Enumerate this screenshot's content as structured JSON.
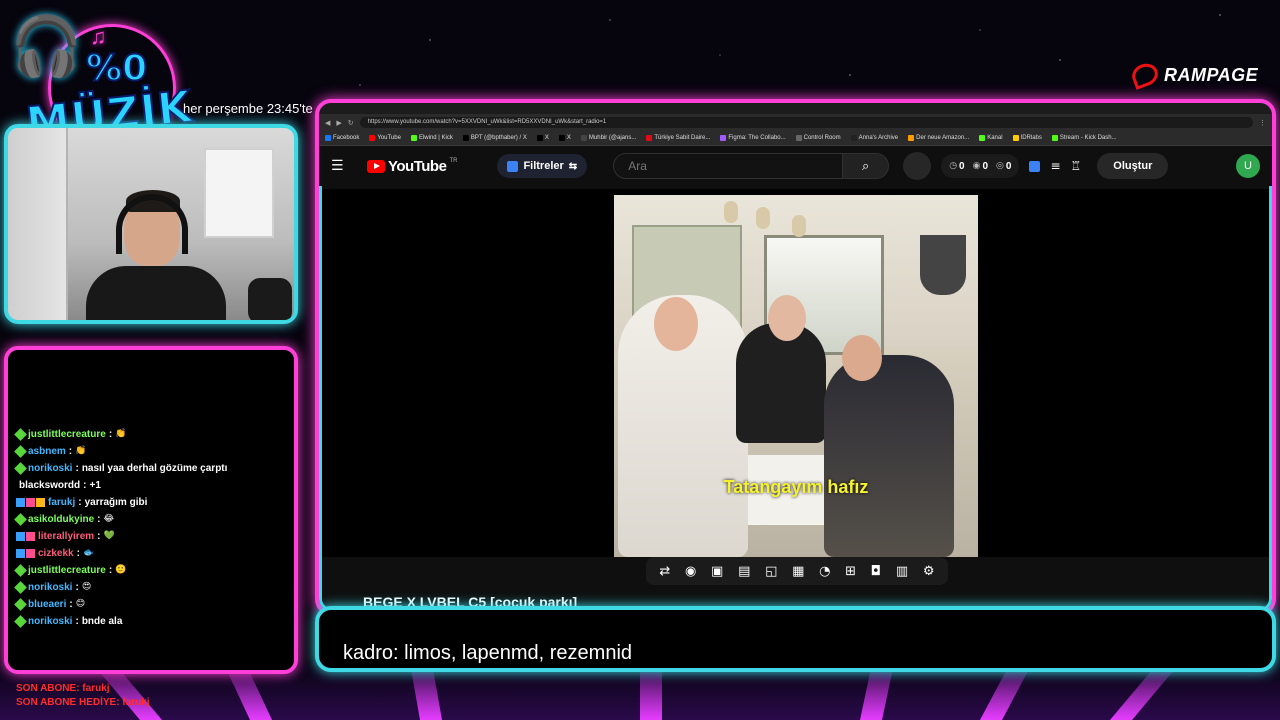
{
  "overlay": {
    "logo": {
      "percent": "%0",
      "word": "MÜZİK"
    },
    "schedule": "her perşembe 23:45'te",
    "sponsor": "RAMPAGE",
    "caption": "kadro: limos, lapenmd, rezemnid",
    "subs": {
      "last_sub": "SON ABONE: farukj",
      "last_gift": "SON ABONE HEDİYE: farukj"
    }
  },
  "chat": {
    "messages": [
      {
        "user": "justlittlecreature",
        "text": "",
        "emoji": "👏",
        "color": "green",
        "badges": [
          "green"
        ]
      },
      {
        "user": "asbnem",
        "text": "",
        "emoji": "👏",
        "color": "cyan",
        "badges": [
          "green"
        ]
      },
      {
        "user": "norikoski",
        "text": "nasıl yaa derhal gözüme çarptı",
        "emoji": "",
        "color": "cyan",
        "badges": [
          "green"
        ]
      },
      {
        "user": "blackswordd",
        "text": "+1",
        "emoji": "",
        "color": "white",
        "badges": []
      },
      {
        "user": "farukj",
        "text": "yarrağım gibi",
        "emoji": "",
        "color": "cyan",
        "badges": [
          "blue",
          "pink",
          "gold"
        ]
      },
      {
        "user": "asikoldukyine",
        "text": "",
        "emoji": "😂",
        "color": "green",
        "badges": [
          "green"
        ]
      },
      {
        "user": "literallyirem",
        "text": "",
        "emoji": "💚",
        "color": "pink",
        "badges": [
          "blue",
          "pink"
        ]
      },
      {
        "user": "cizkekk",
        "text": "",
        "emoji": "🐟",
        "color": "pink",
        "badges": [
          "blue",
          "pink"
        ]
      },
      {
        "user": "justlittlecreature",
        "text": "",
        "emoji": "🙂",
        "color": "green",
        "badges": [
          "green"
        ]
      },
      {
        "user": "norikoski",
        "text": "",
        "emoji": "😍",
        "color": "cyan",
        "badges": [
          "green"
        ]
      },
      {
        "user": "blueaeri",
        "text": "",
        "emoji": "😊",
        "color": "cyan",
        "badges": [
          "green"
        ]
      },
      {
        "user": "norikoski",
        "text": "bnde ala",
        "emoji": "",
        "color": "cyan",
        "badges": [
          "green"
        ]
      }
    ]
  },
  "browser": {
    "url": "https://www.youtube.com/watch?v=5XXVDNI_uWk&list=RD5XXVDNI_uWk&start_radio=1",
    "bookmarks": [
      "Facebook",
      "YouTube",
      "Elwind | Kick",
      "BPT (@bpthaber) / X",
      "X",
      "X",
      "Muhbir (@ajans...",
      "Türkiye Sabit Daire...",
      "Figma: The Collabo...",
      "Control Room",
      "Anna's Archive",
      "Der neue Amazon...",
      "Kanal",
      "IDRlabs",
      "Stream - Kick Dash..."
    ]
  },
  "youtube": {
    "logo_text": "YouTube",
    "region": "TR",
    "filter_label": "Filtreler",
    "search_placeholder": "Ara",
    "stats": [
      "0",
      "0",
      "0"
    ],
    "create_label": "Oluştur",
    "avatar_letter": "U",
    "video_title": "BEGE X LVBEL C5 [çocuk parkı]",
    "lyric": "Tatangayım hafız"
  }
}
